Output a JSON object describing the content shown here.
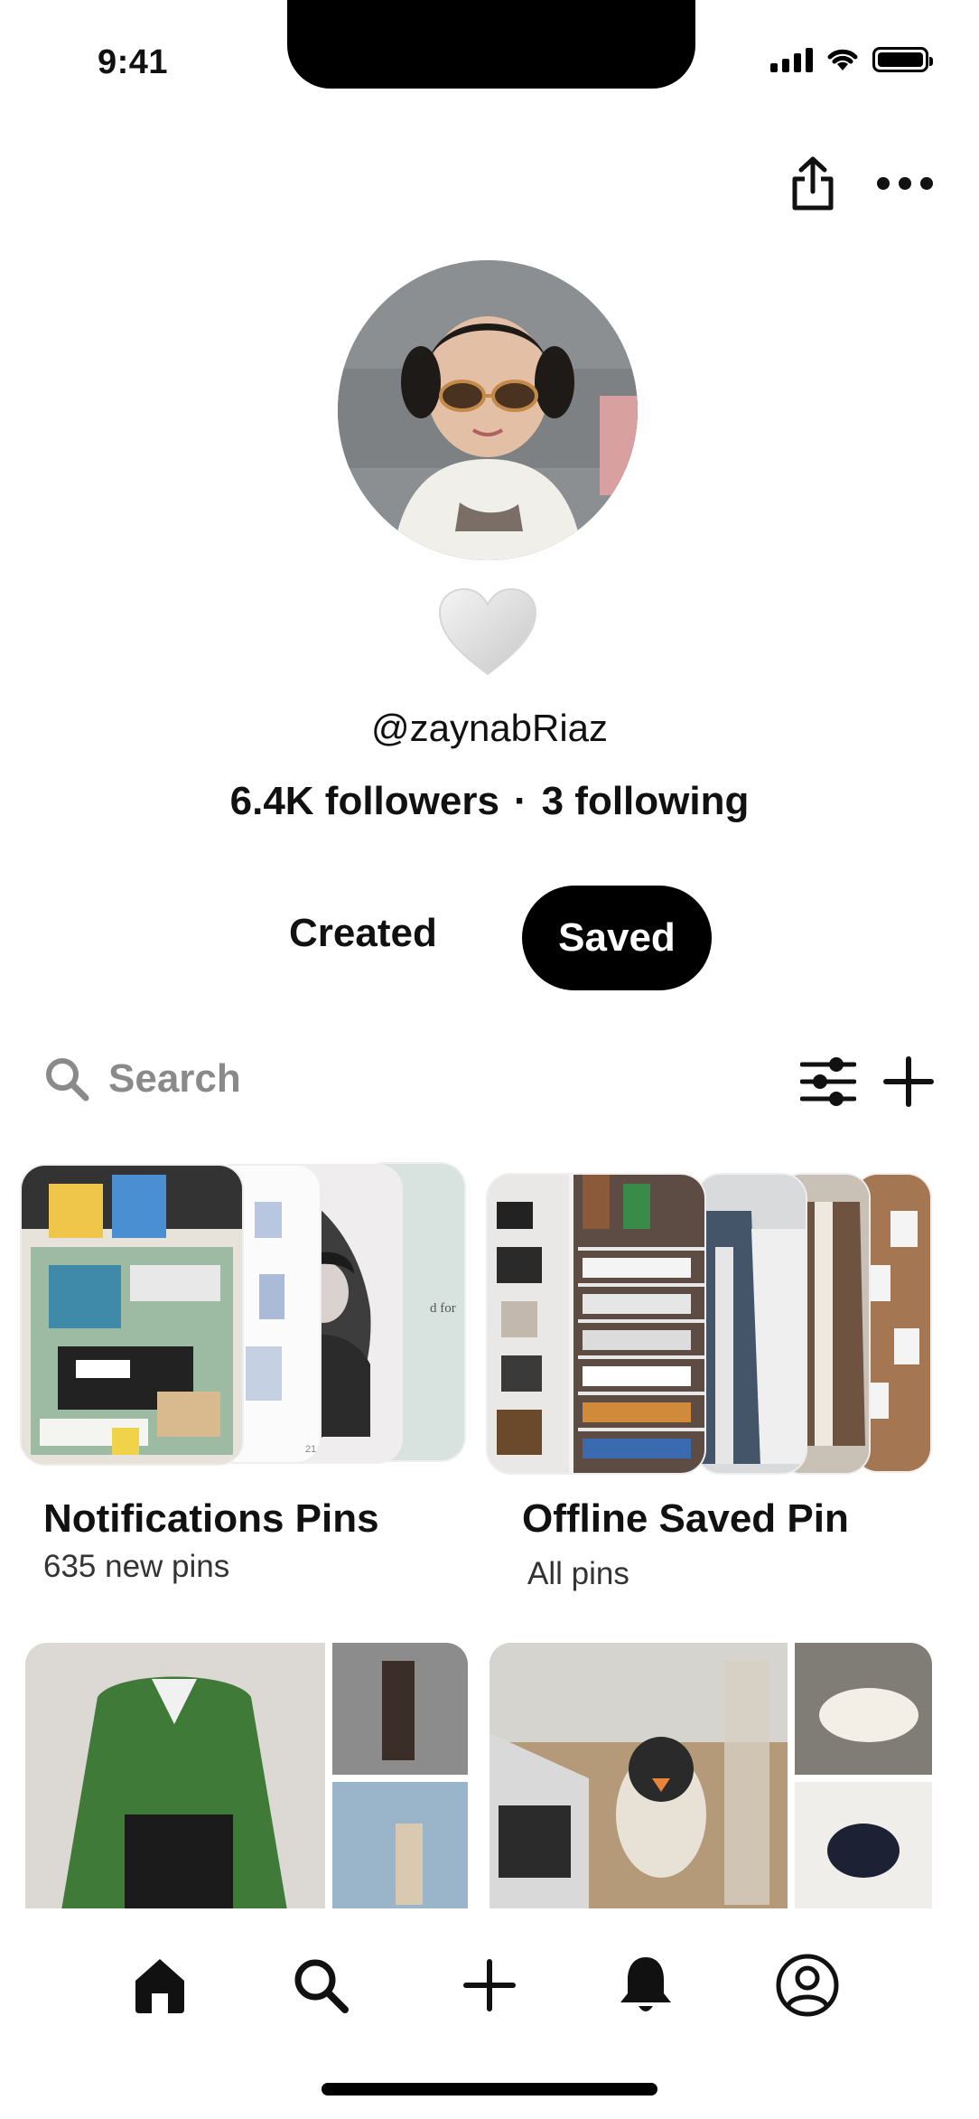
{
  "status_bar": {
    "time": "9:41"
  },
  "profile": {
    "handle": "@zaynabRiaz",
    "followers": "6.4K followers",
    "separator": "·",
    "following": "3 following"
  },
  "tabs": {
    "created": "Created",
    "saved": "Saved",
    "active": "Saved"
  },
  "search": {
    "placeholder": "Search"
  },
  "boards": [
    {
      "title": "Notifications Pins",
      "subtitle": "635 new pins",
      "preview_text": "d for",
      "preview_text_2": "21"
    },
    {
      "title": "Offline Saved Pin",
      "subtitle": "All pins"
    }
  ],
  "icons": {
    "share": "share-icon",
    "more": "more-icon",
    "heart": "heart-icon",
    "search": "search-icon",
    "filter": "filter-icon",
    "add": "plus-icon",
    "nav": [
      "home-icon",
      "search-icon",
      "plus-icon",
      "bell-icon",
      "profile-icon"
    ]
  },
  "colors": {
    "accent": "#000000",
    "muted": "#8a8a8a",
    "background": "#ffffff"
  }
}
